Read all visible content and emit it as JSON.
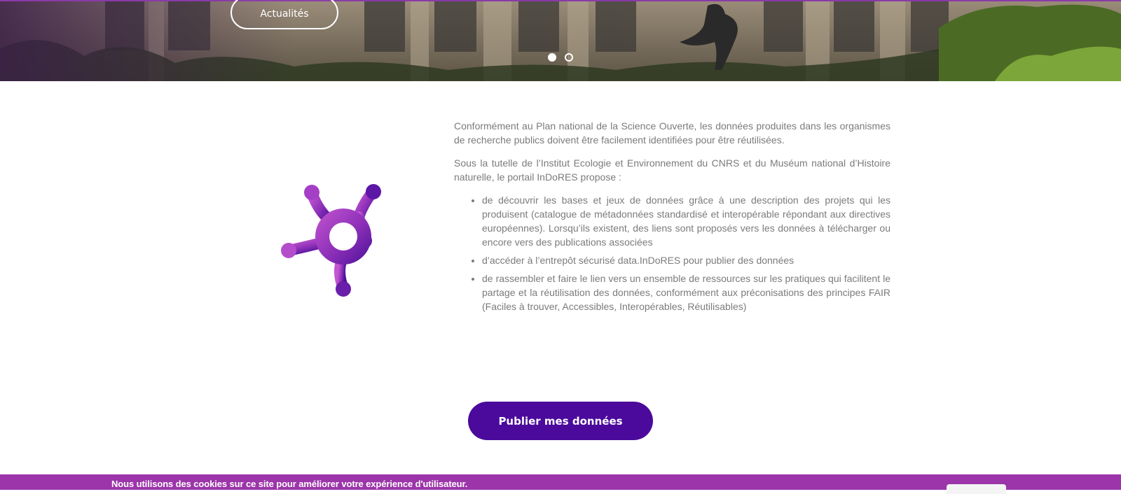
{
  "hero": {
    "button_label": "Actualités",
    "slides": [
      {
        "state": "active"
      },
      {
        "state": "inactive"
      }
    ]
  },
  "intro": {
    "paragraphs": [
      "Conformément au Plan national de la Science Ouverte, les données produites dans les organismes de recherche publics doivent être facilement identifiées pour être réutilisées.",
      "Sous la tutelle de l’Institut Ecologie et Environnement du CNRS et du Muséum national d’Histoire naturelle, le portail InDoRES propose :"
    ],
    "bullets": [
      "de découvrir les bases et jeux de données grâce à une description des projets qui les produisent (catalogue de métadonnées standardisé et interopérable répondant aux directives européennes). Lorsqu’ils existent, des liens sont proposés vers les données à télécharger ou encore vers des publications associées",
      "d’accéder à l’entrepôt sécurisé data.InDoRES pour publier des données",
      "de rassembler et faire le lien vers un ensemble de ressources sur les pratiques qui facilitent le partage et la réutilisation des données, conformément aux préconisations des principes FAIR (Faciles à trouver, Accessibles, Interopérables, Réutilisables)"
    ]
  },
  "cta": {
    "label": "Publier mes données"
  },
  "cookie": {
    "message": "Nous utilisons des cookies sur ce site pour améliorer votre expérience d'utilisateur."
  },
  "colors": {
    "brand_purple": "#4b0a9c",
    "cookie_bar": "#9b35a9",
    "body_text": "#7b7b7b"
  },
  "icons": {
    "logo": "indores-molecule-logo"
  }
}
